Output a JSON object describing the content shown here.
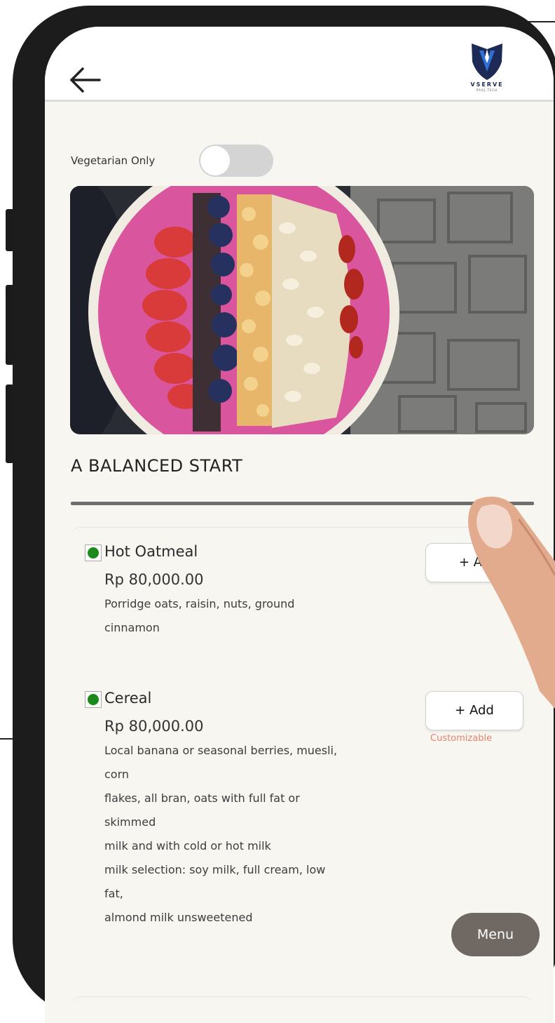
{
  "header": {
    "back_icon": "arrow-left-icon",
    "logo_text": "VSERVE",
    "logo_subtext": "PROJ.TECH",
    "brand_colors": {
      "logo_dark": "#1d2a55",
      "logo_blue": "#2f6fd8"
    }
  },
  "filter": {
    "vegetarian_label": "Vegetarian Only",
    "vegetarian_on": false
  },
  "hero_image": "acai-bowl-photo",
  "section": {
    "title": "A BALANCED START"
  },
  "items": [
    {
      "name": "Hot Oatmeal",
      "price": "Rp 80,000.00",
      "description": [
        "Porridge oats, raisin, nuts, ground",
        "cinnamon"
      ],
      "add_label": "+ Ad",
      "vegetarian": true
    },
    {
      "name": "Cereal",
      "price": "Rp 80,000.00",
      "description": [
        "Local banana or seasonal berries, muesli,",
        "corn",
        "flakes, all bran, oats with full fat or",
        "skimmed",
        "milk and with cold or hot milk",
        "milk selection: soy milk, full cream, low",
        "fat,",
        "almond milk unsweetened"
      ],
      "add_label": "+ Add",
      "customizable": "Customizable",
      "vegetarian": true
    }
  ],
  "menu_button": "Menu",
  "colors": {
    "veg_green": "#1a8a1a",
    "customizable": "#e6836b",
    "menu_button_bg": "#6f6863"
  }
}
